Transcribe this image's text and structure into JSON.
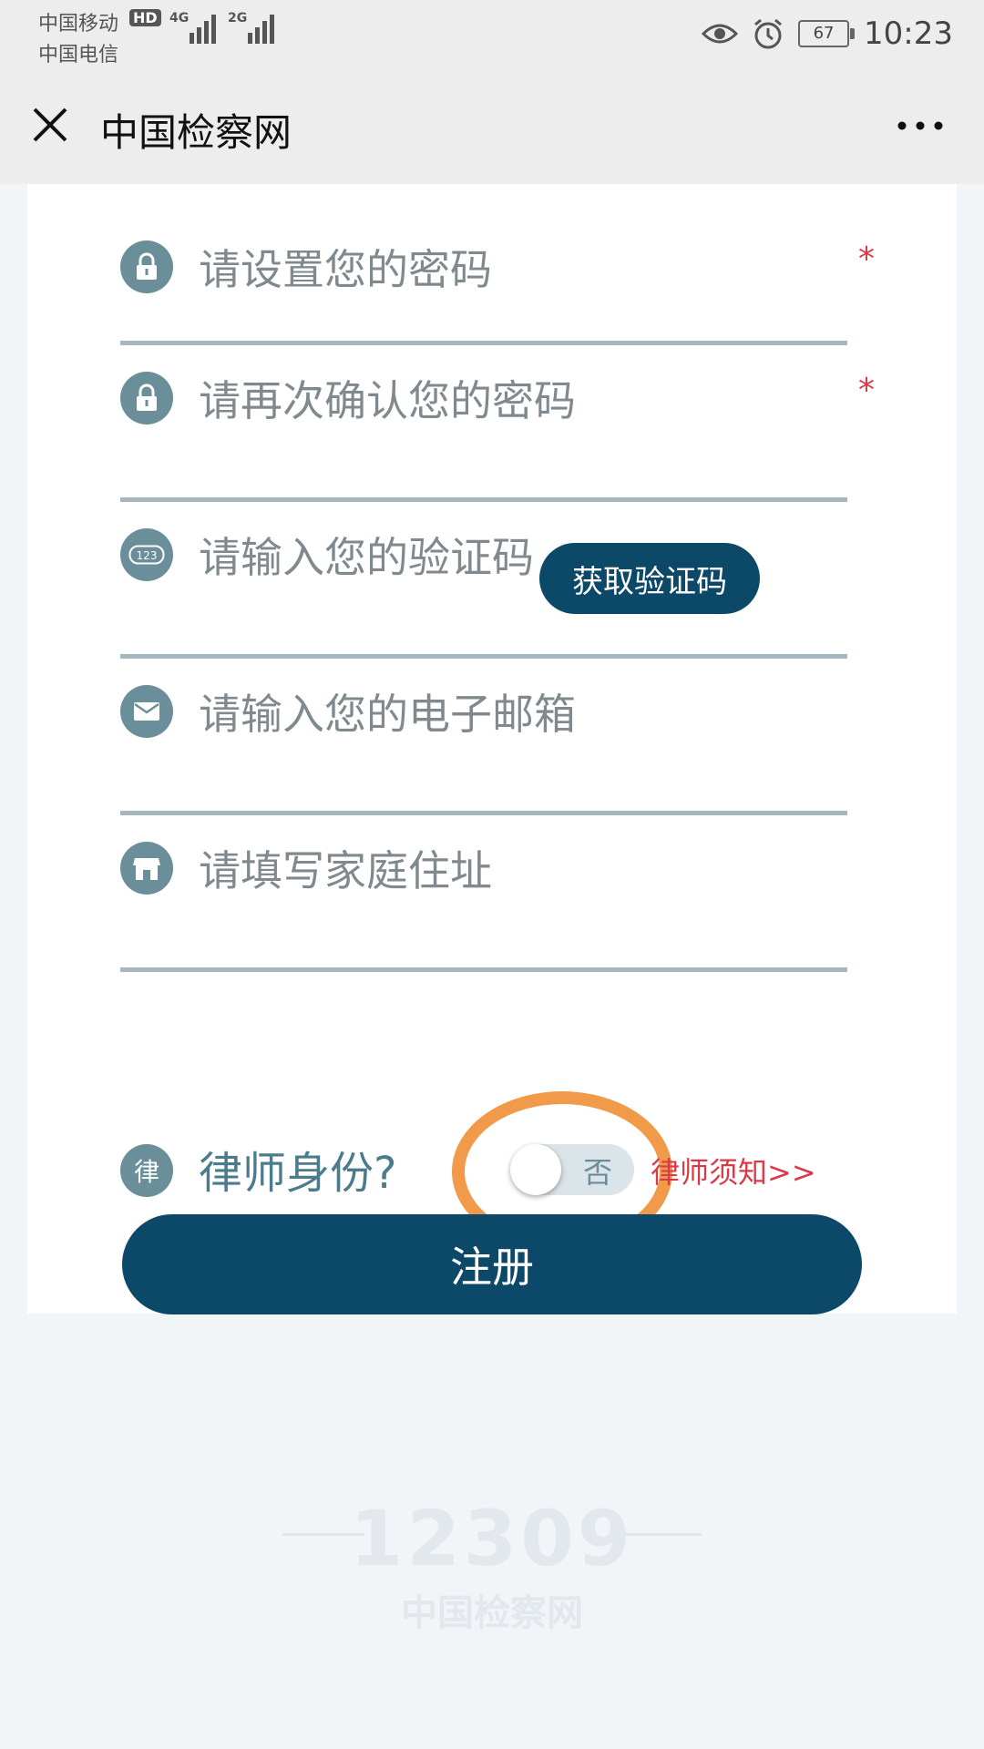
{
  "status_bar": {
    "carrier_1": "中国移动",
    "carrier_2": "中国电信",
    "hd": "HD",
    "network_1": "4G",
    "network_2": "2G",
    "battery": "67",
    "time": "10:23"
  },
  "title_bar": {
    "title": "中国检察网"
  },
  "form": {
    "fields": [
      {
        "placeholder": "请设置您的密码",
        "required": "*",
        "icon": "lock-icon"
      },
      {
        "placeholder": "请再次确认您的密码",
        "required": "*",
        "icon": "lock-icon"
      },
      {
        "placeholder": "请输入您的验证码",
        "icon": "code-icon",
        "button": "获取验证码"
      },
      {
        "placeholder": "请输入您的电子邮箱",
        "icon": "mail-icon"
      },
      {
        "placeholder": "请填写家庭住址",
        "icon": "home-icon"
      }
    ],
    "lawyer": {
      "icon_char": "律",
      "label": "律师身份?",
      "toggle_label": "否",
      "notice": "律师须知>>"
    },
    "register_label": "注册"
  },
  "watermark": {
    "number": "12309",
    "text": "中国检察网"
  },
  "colors": {
    "primary": "#0c4867",
    "icon_bg": "#6b8e9b",
    "required": "#d93a4a",
    "highlight": "#f09a4a"
  }
}
